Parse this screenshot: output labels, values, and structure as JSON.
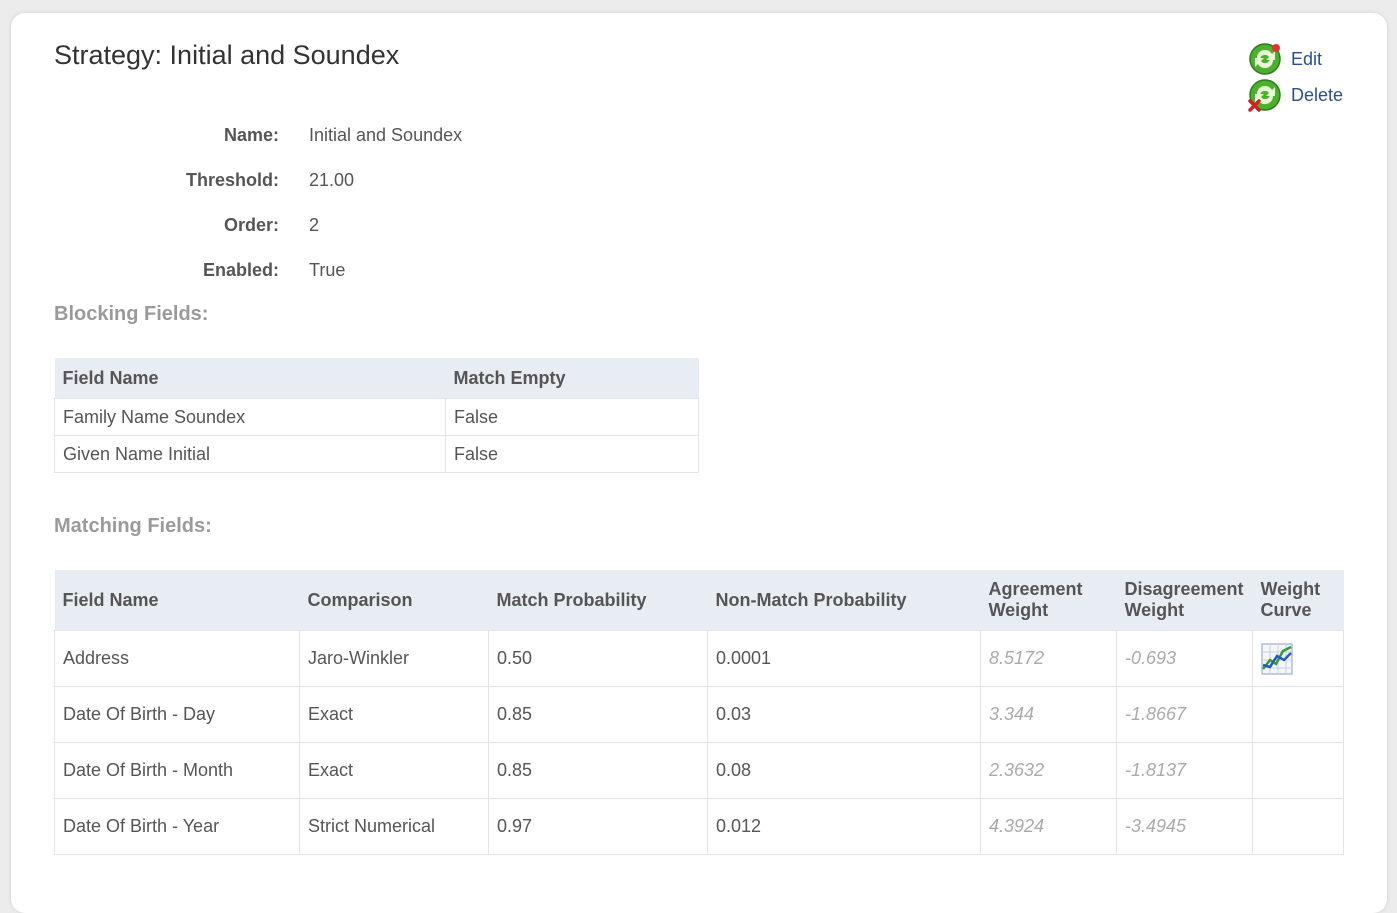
{
  "page": {
    "title": "Strategy: Initial and Soundex"
  },
  "actions": {
    "edit": "Edit",
    "delete": "Delete"
  },
  "details": [
    {
      "label": "Name:",
      "value": "Initial and Soundex"
    },
    {
      "label": "Threshold:",
      "value": "21.00"
    },
    {
      "label": "Order:",
      "value": "2"
    },
    {
      "label": "Enabled:",
      "value": "True"
    }
  ],
  "blocking": {
    "heading": "Blocking Fields:",
    "columns": [
      "Field Name",
      "Match Empty"
    ],
    "rows": [
      [
        "Family Name Soundex",
        "False"
      ],
      [
        "Given Name Initial",
        "False"
      ]
    ]
  },
  "matching": {
    "heading": "Matching Fields:",
    "columns": {
      "field_name": "Field Name",
      "comparison": "Comparison",
      "match_probability": "Match Probability",
      "non_match_probability": "Non-Match Probability",
      "agreement_weight": [
        "Agreement",
        "Weight"
      ],
      "disagreement_weight": [
        "Disagreement",
        "Weight"
      ],
      "weight_curve": [
        "Weight",
        "Curve"
      ]
    },
    "rows": [
      {
        "field": "Address",
        "comparison": "Jaro-Winkler",
        "match": "0.50",
        "nonmatch": "0.0001",
        "agree": "8.5172",
        "disagree": "-0.693",
        "curve_icon": "weight-curve-chart-icon"
      },
      {
        "field": "Date Of Birth - Day",
        "comparison": "Exact",
        "match": "0.85",
        "nonmatch": "0.03",
        "agree": "3.344",
        "disagree": "-1.8667"
      },
      {
        "field": "Date Of Birth - Month",
        "comparison": "Exact",
        "match": "0.85",
        "nonmatch": "0.08",
        "agree": "2.3632",
        "disagree": "-1.8137"
      },
      {
        "field": "Date Of Birth - Year",
        "comparison": "Strict Numerical",
        "match": "0.97",
        "nonmatch": "0.012",
        "agree": "4.3924",
        "disagree": "-3.4945"
      }
    ]
  },
  "colors": {
    "link": "#2c4f8c",
    "header_bg": "#e8edf4",
    "section_heading": "#9a9a9a",
    "weight_text": "#aaaaaa"
  }
}
